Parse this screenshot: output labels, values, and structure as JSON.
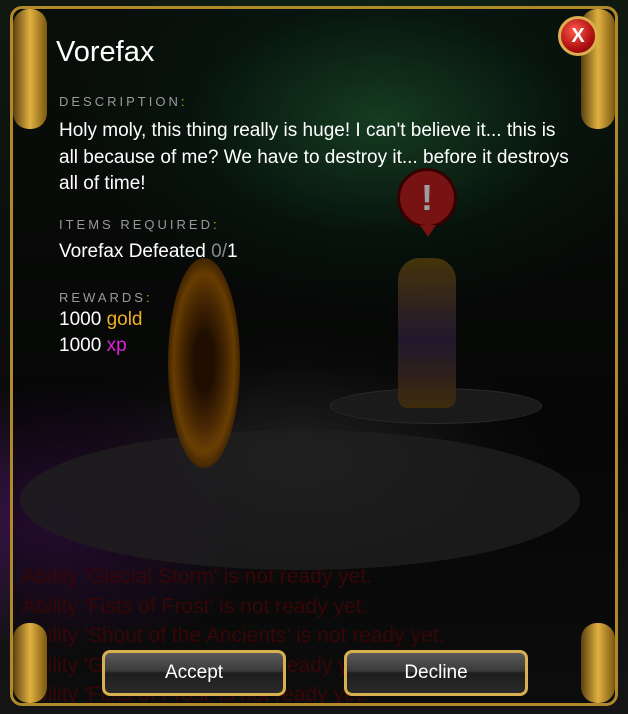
{
  "quest": {
    "title": "Vorefax",
    "description_label": "DESCRIPTION",
    "description": "Holy moly, this thing really is huge! I can't believe it... this is all because of me? We have to destroy it... before it destroys all of time!",
    "items_label": "ITEMS REQUIRED",
    "items": [
      {
        "name": "Vorefax Defeated",
        "have": "0",
        "need": "1"
      }
    ],
    "rewards_label": "REWARDS",
    "rewards": [
      {
        "amount": "1000",
        "unit": "gold"
      },
      {
        "amount": "1000",
        "unit": "xp"
      }
    ],
    "accept_label": "Accept",
    "decline_label": "Decline",
    "close_glyph": "X"
  },
  "chat_log": [
    "Ability 'Glacial Storm' is not ready yet.",
    "Ability 'Fists of Frost' is not ready yet.",
    "Ability 'Shout of the Ancients' is not ready yet.",
    "Ability 'Glacial Storm' is not ready yet.",
    "Ability 'Fists of Frost' is not ready yet."
  ],
  "scene": {
    "alert_glyph": "!"
  },
  "colors": {
    "frame_gold": "#b08a2a",
    "gold_text": "#f0b020",
    "xp_text": "#e020e0",
    "label_grey": "#9a9a9a",
    "chat_red": "#5a0a0a"
  }
}
